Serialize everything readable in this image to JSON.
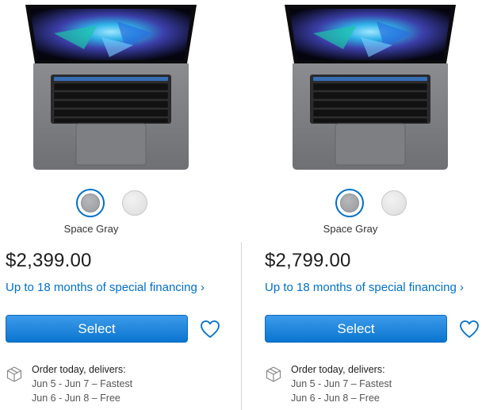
{
  "colors": {
    "accent": "#0070c9",
    "button_bg": "#1580d6",
    "text": "#1d1d1f",
    "muted": "#555555"
  },
  "products": [
    {
      "swatches": [
        {
          "name": "Space Gray",
          "selected": true
        },
        {
          "name": "Silver",
          "selected": false
        }
      ],
      "color_label": "Space Gray",
      "price": "$2,399.00",
      "financing": "Up to 18 months of special financing ›",
      "select_label": "Select",
      "delivery": {
        "heading": "Order today, delivers:",
        "options": [
          "Jun 5 - Jun 7 – Fastest",
          "Jun 6 - Jun 8 – Free"
        ]
      },
      "icons": {
        "favorite": "heart-icon",
        "shipping": "box-icon"
      }
    },
    {
      "swatches": [
        {
          "name": "Space Gray",
          "selected": true
        },
        {
          "name": "Silver",
          "selected": false
        }
      ],
      "color_label": "Space Gray",
      "price": "$2,799.00",
      "financing": "Up to 18 months of special financing ›",
      "select_label": "Select",
      "delivery": {
        "heading": "Order today, delivers:",
        "options": [
          "Jun 5 - Jun 7 – Fastest",
          "Jun 6 - Jun 8 – Free"
        ]
      },
      "icons": {
        "favorite": "heart-icon",
        "shipping": "box-icon"
      }
    }
  ]
}
